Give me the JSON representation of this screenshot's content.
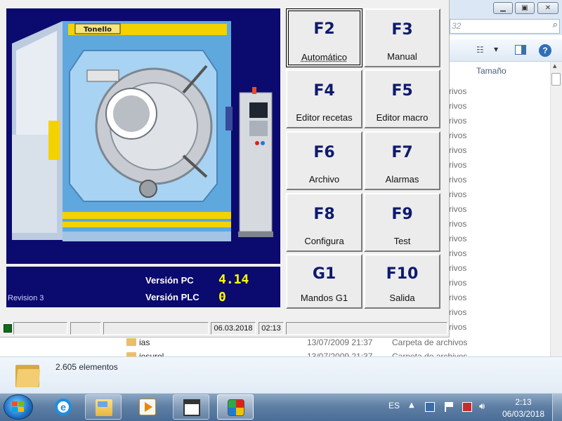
{
  "explorer": {
    "search_placeholder": "32",
    "column_size": "Tamaño",
    "row_type_text": "rivos",
    "row_tops": [
      123,
      144,
      165,
      186,
      207,
      228,
      249,
      270,
      291,
      312,
      333,
      354,
      375,
      396,
      417,
      438,
      459
    ],
    "bottom_rows": [
      {
        "name": "ias",
        "date": "13/07/2009 21:37",
        "type": "Carpeta de archivos"
      },
      {
        "name": "iesurol",
        "date": "13/07/2009 21:37",
        "type": "Carpeta de archivos"
      }
    ],
    "item_count": "2.605 elementos"
  },
  "app": {
    "machine_brand": "Tonello",
    "revision": "Revision 3",
    "version_pc_label": "Versión PC",
    "version_pc_value": "4.14",
    "version_plc_label": "Versión PLC",
    "version_plc_value": "0",
    "function_buttons": [
      {
        "key": "F2",
        "label": "Automático"
      },
      {
        "key": "F3",
        "label": "Manual"
      },
      {
        "key": "F4",
        "label": "Editor recetas"
      },
      {
        "key": "F5",
        "label": "Editor macro"
      },
      {
        "key": "F6",
        "label": "Archivo"
      },
      {
        "key": "F7",
        "label": "Alarmas"
      },
      {
        "key": "F8",
        "label": "Configura"
      },
      {
        "key": "F9",
        "label": "Test"
      },
      {
        "key": "G1",
        "label": "Mandos G1"
      },
      {
        "key": "F10",
        "label": "Salida"
      }
    ],
    "status": {
      "date": "06.03.2018",
      "time": "02:13",
      "led_color": "#0e6d1a"
    },
    "colors": {
      "panel_bg": "#0b0a6f",
      "version_value": "#ffff00",
      "key_text": "#0d1a6e"
    }
  },
  "taskbar": {
    "apps": [
      "start-icon",
      "internet-explorer-icon",
      "file-explorer-icon",
      "media-player-icon",
      "window-icon",
      "tonello-app-icon"
    ],
    "language": "ES",
    "clock_time": "2:13",
    "clock_date": "06/03/2018"
  }
}
